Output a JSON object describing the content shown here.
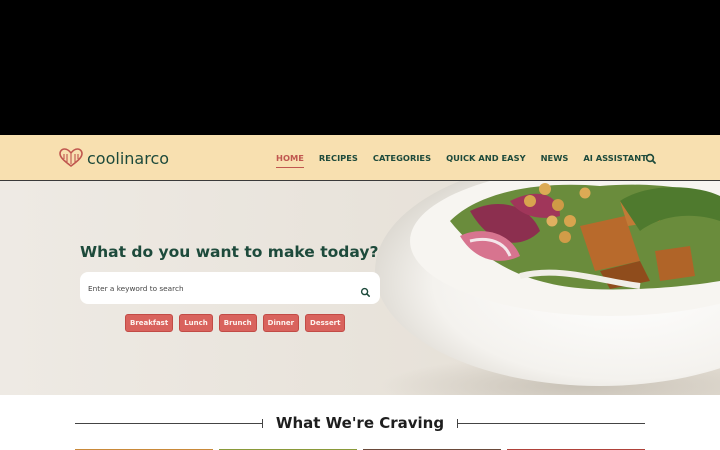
{
  "brand": {
    "name": "coolinarco",
    "accent": "#c0574f",
    "dark_green": "#1d4a3b",
    "nav_bg": "#f8e0b0"
  },
  "nav": {
    "items": [
      {
        "label": "HOME",
        "active": true
      },
      {
        "label": "RECIPES",
        "active": false
      },
      {
        "label": "CATEGORIES",
        "active": false
      },
      {
        "label": "QUICK AND EASY",
        "active": false
      },
      {
        "label": "NEWS",
        "active": false
      },
      {
        "label": "AI ASSISTANT",
        "active": false
      }
    ],
    "search_icon": "search-icon"
  },
  "hero": {
    "title": "What do you want to make today?",
    "search_placeholder": "Enter a keyword to search",
    "search_icon": "search-icon",
    "chips": [
      "Breakfast",
      "Lunch",
      "Brunch",
      "Dinner",
      "Dessert"
    ],
    "chip_color": "#d9635d"
  },
  "section": {
    "title": "What We're Craving"
  }
}
